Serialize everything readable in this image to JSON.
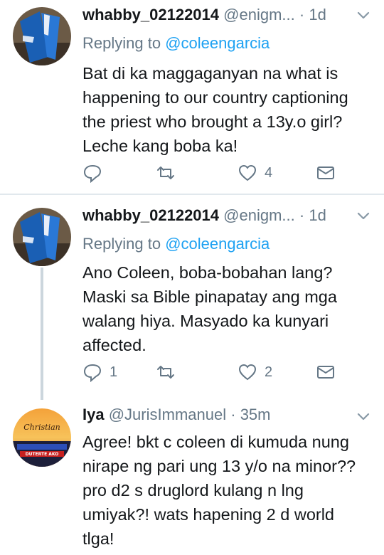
{
  "colors": {
    "link": "#1da1f2",
    "muted": "#657786",
    "text": "#14171a",
    "divider": "#e1e8ed"
  },
  "tweets": [
    {
      "name": "whabby_02122014",
      "handle": "@enigm...",
      "dot": "·",
      "time": "1d",
      "reply_prefix": "Replying to",
      "reply_to": "@coleengarcia",
      "lines": [
        "Bat di ka maggaganyan  na what is",
        "happening to our country captioning",
        "the priest who brought a 13y.o girl?",
        "Leche kang boba ka!"
      ],
      "replies": "",
      "retweets": "",
      "likes": "4"
    },
    {
      "name": "whabby_02122014",
      "handle": "@enigm...",
      "dot": "·",
      "time": "1d",
      "reply_prefix": "Replying to",
      "reply_to": "@coleengarcia",
      "lines": [
        "Ano Coleen, boba-bobahan lang?",
        "Maski sa Bible pinapatay ang mga",
        "walang hiya. Masyado ka kunyari",
        "affected."
      ],
      "replies": "1",
      "retweets": "",
      "likes": "2"
    },
    {
      "name": "Iya",
      "handle": "@JurisImmanuel",
      "dot": "·",
      "time": "35m",
      "lines": [
        "Agree! bkt c coleen di kumuda nung",
        "nirape ng pari ung 13 y/o na minor??",
        "pro d2 s druglord kulang n lng",
        "umiyak?! wats hapening 2 d world",
        "tlga!"
      ],
      "avatar_text": [
        "Christian",
        "DUTERTE AKO"
      ]
    }
  ]
}
